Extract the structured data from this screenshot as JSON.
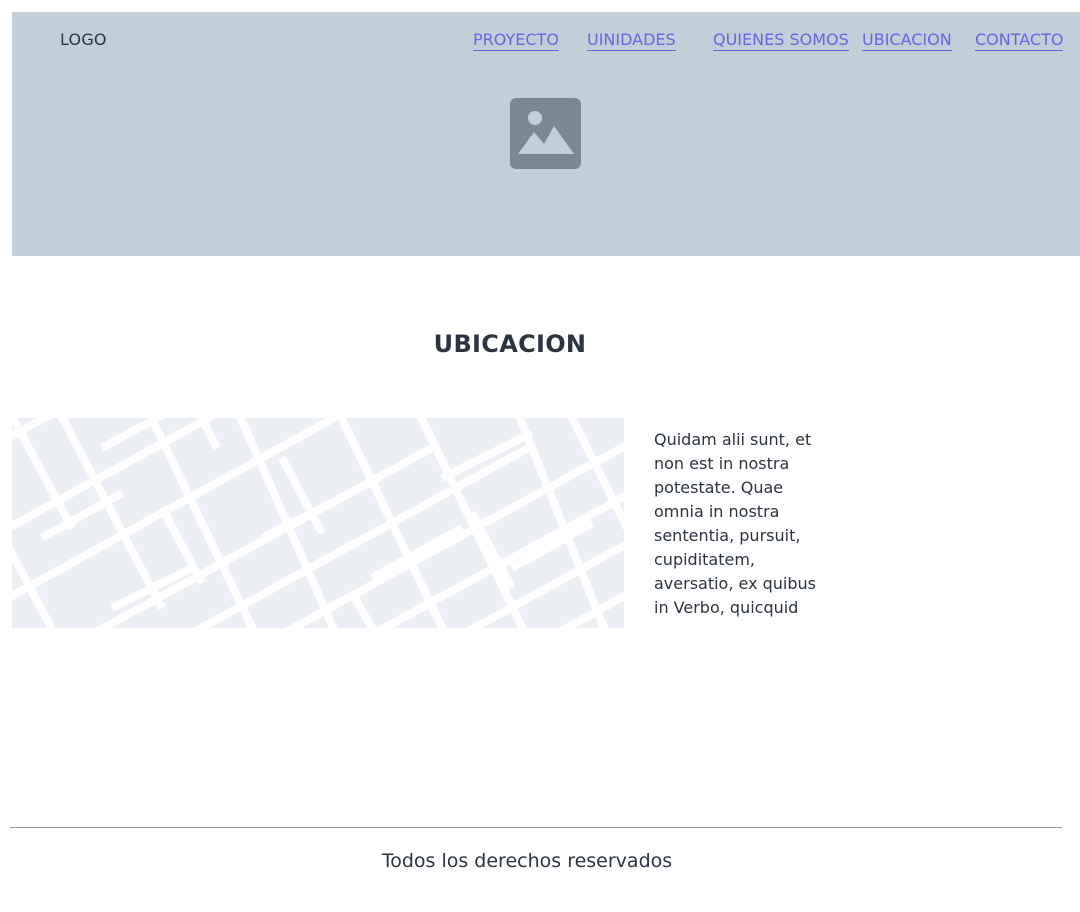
{
  "header": {
    "logo_text": "LOGO",
    "nav": {
      "proyecto": "PROYECTO",
      "unidades": "UINIDADES",
      "quienes_somos": "QUIENES SOMOS",
      "ubicacion": "UBICACION",
      "contacto": "CONTACTO"
    },
    "hero_icon": "image-placeholder-icon"
  },
  "main": {
    "section_title": "UBICACION",
    "map_icon": "map-placeholder",
    "description": "Quidam alii sunt, et non est in nostra potestate. Quae omnia in nostra sententia, pursuit, cupiditatem, aversatio, ex quibus in Verbo, quicquid"
  },
  "footer": {
    "copyright": "Todos los derechos reservados"
  },
  "colors": {
    "header_bg": "#c3cfd8",
    "link": "#6a63e6",
    "text": "#2b3440",
    "map_bg": "#eceff4",
    "icon": "#7b8896",
    "divider": "#8a99a8"
  }
}
